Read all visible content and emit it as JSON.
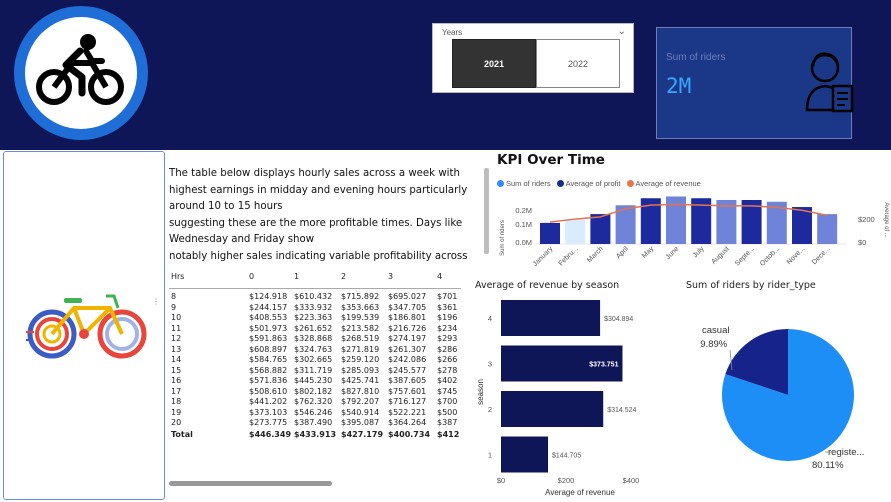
{
  "slicer": {
    "title": "Years",
    "options": [
      "2021",
      "2022"
    ],
    "selected": "2021"
  },
  "kpi_card": {
    "label": "Sum of riders",
    "value": "2M"
  },
  "description": [
    "The table below displays hourly sales across a week with",
    "highest earnings in midday and evening hours particularly",
    "around 10 to 15 hours",
    "suggesting these are the more profitable times. Days like",
    "Wednesday and Friday show",
    "notably higher sales indicating variable profitability across"
  ],
  "table": {
    "columns": [
      "Hrs",
      "0",
      "1",
      "2",
      "3",
      "4"
    ],
    "rows": [
      [
        "8",
        "$124.918",
        "$610.432",
        "$715.892",
        "$695.027",
        "$701"
      ],
      [
        "9",
        "$244.157",
        "$333.932",
        "$353.663",
        "$347.705",
        "$361"
      ],
      [
        "10",
        "$408.553",
        "$223.363",
        "$199.539",
        "$186.801",
        "$196"
      ],
      [
        "11",
        "$501.973",
        "$261.652",
        "$213.582",
        "$216.726",
        "$234"
      ],
      [
        "12",
        "$591.863",
        "$328.868",
        "$268.519",
        "$274.197",
        "$293"
      ],
      [
        "13",
        "$608.897",
        "$324.763",
        "$271.819",
        "$261.307",
        "$286"
      ],
      [
        "14",
        "$584.765",
        "$302.665",
        "$259.120",
        "$242.086",
        "$266"
      ],
      [
        "15",
        "$568.882",
        "$311.719",
        "$285.093",
        "$245.577",
        "$278"
      ],
      [
        "16",
        "$571.836",
        "$445.230",
        "$425.741",
        "$387.605",
        "$402"
      ],
      [
        "17",
        "$508.610",
        "$802.182",
        "$827.810",
        "$757.601",
        "$745"
      ],
      [
        "18",
        "$441.202",
        "$762.320",
        "$792.207",
        "$716.127",
        "$700"
      ],
      [
        "19",
        "$373.103",
        "$546.246",
        "$540.914",
        "$522.221",
        "$500"
      ],
      [
        "20",
        "$273.775",
        "$387.490",
        "$395.087",
        "$364.264",
        "$387"
      ]
    ],
    "total": [
      "Total",
      "$446.349",
      "$433.913",
      "$427.179",
      "$400.734",
      "$412"
    ]
  },
  "kpi_over_time": {
    "title": "KPI Over Time",
    "legend": [
      "Sum of riders",
      "Average of profit",
      "Average of revenue"
    ],
    "legend_colors": [
      "#2f8cff",
      "#1a2a8a",
      "#e8734a"
    ],
    "ylabel_left": "Sum of riders",
    "ylabel_right": "Average of ...",
    "yticks_left": [
      "0.0M",
      "0.1M",
      "0.2M"
    ],
    "yticks_right": [
      "$0",
      "$200"
    ]
  },
  "revenue_by_season": {
    "title": "Average of revenue by season",
    "ylabel": "season",
    "xlabel": "Average of revenue",
    "xticks": [
      "$0",
      "$200",
      "$400"
    ]
  },
  "riders_by_type": {
    "title": "Sum of riders by rider_type",
    "labels": [
      {
        "name": "casual",
        "pct": "19.89%"
      },
      {
        "name": "registe...",
        "pct": "80.11%"
      }
    ]
  },
  "chart_data": [
    {
      "type": "bar",
      "title": "KPI Over Time",
      "categories": [
        "January",
        "Febru...",
        "March",
        "April",
        "May",
        "June",
        "July",
        "August",
        "Septe...",
        "Octob...",
        "Nove...",
        "Dece..."
      ],
      "series": [
        {
          "name": "Sum of riders",
          "values": [
            0.12,
            0.14,
            0.17,
            0.22,
            0.26,
            0.27,
            0.26,
            0.25,
            0.25,
            0.24,
            0.21,
            0.17
          ]
        },
        {
          "name": "Average of revenue",
          "values": [
            150,
            170,
            185,
            240,
            265,
            270,
            265,
            260,
            260,
            250,
            230,
            195
          ]
        }
      ],
      "highlighted_category": "Febru...",
      "bar_colors": [
        "#1c2a9e",
        "#d9ecff",
        "#1c2a9e",
        "#6f84d8",
        "#1c2a9e",
        "#6f84d8",
        "#1c2a9e",
        "#6f84d8",
        "#1c2a9e",
        "#6f84d8",
        "#1c2a9e",
        "#6f84d8"
      ],
      "ylim_left": [
        0,
        0.25
      ],
      "ylim_right": [
        0,
        300
      ]
    },
    {
      "type": "bar",
      "orientation": "horizontal",
      "title": "Average of revenue by season",
      "categories": [
        "4",
        "3",
        "2",
        "1"
      ],
      "values": [
        304.894,
        373.751,
        314.524,
        144.705
      ],
      "data_labels": [
        "$304.894",
        "$373.751",
        "$314.524",
        "$144.705"
      ],
      "xlabel": "Average of revenue",
      "ylabel": "season",
      "xlim": [
        0,
        420
      ]
    },
    {
      "type": "pie",
      "title": "Sum of riders by rider_type",
      "categories": [
        "casual",
        "registe..."
      ],
      "values": [
        19.89,
        80.11
      ],
      "colors": [
        "#15238a",
        "#1c8ef5"
      ]
    }
  ]
}
